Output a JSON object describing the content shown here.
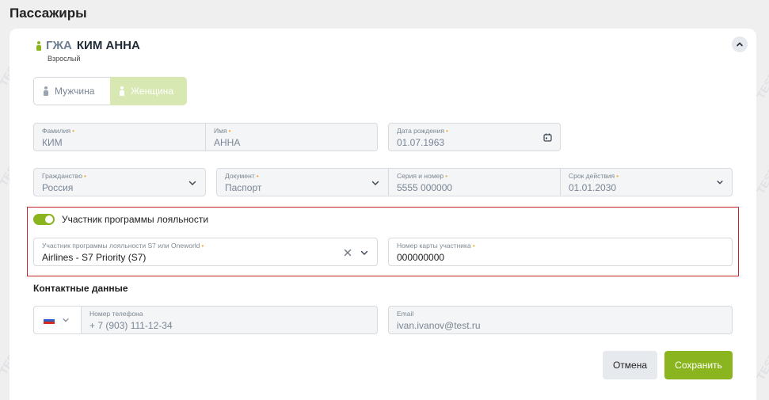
{
  "page": {
    "title": "Пассажиры"
  },
  "passenger": {
    "last_name": "ГЖА",
    "first_name": "КИМ АННА",
    "type": "Взрослый"
  },
  "gender": {
    "male": "Мужчина",
    "female": "Женщина",
    "selected": "female"
  },
  "fields": {
    "surname": {
      "label": "Фамилия",
      "value": "КИМ"
    },
    "name": {
      "label": "Имя",
      "value": "АННА"
    },
    "birth_date": {
      "label": "Дата рождения",
      "value": "01.07.1963"
    },
    "citizenship": {
      "label": "Гражданство",
      "value": "Россия"
    },
    "document": {
      "label": "Документ",
      "value": "Паспорт"
    },
    "series_number": {
      "label": "Серия и номер",
      "value": "5555 000000"
    },
    "validity": {
      "label": "Срок действия",
      "value": "01.01.2030"
    }
  },
  "loyalty": {
    "toggle_label": "Участник программы лояльности",
    "enabled": true,
    "program": {
      "label": "Участник программы лояльности S7 или Oneworld",
      "value": "Airlines - S7 Priority (S7)"
    },
    "card": {
      "label": "Номер карты участника",
      "value": "000000000"
    }
  },
  "contacts": {
    "title": "Контактные данные",
    "phone": {
      "label": "Номер телефона",
      "value": "+ 7 (903) 111-12-34"
    },
    "email": {
      "label": "Email",
      "value": "ivan.ivanov@test.ru"
    }
  },
  "buttons": {
    "cancel": "Отмена",
    "save": "Сохранить"
  },
  "watermark": "TEST",
  "colors": {
    "accent": "#8ab51f",
    "highlight_border": "#c8242e",
    "required": "#f5a623"
  },
  "icons": [
    "person-icon",
    "chevron-up-icon",
    "calendar-icon",
    "chevron-down-icon",
    "clear-icon",
    "russia-flag-icon"
  ]
}
